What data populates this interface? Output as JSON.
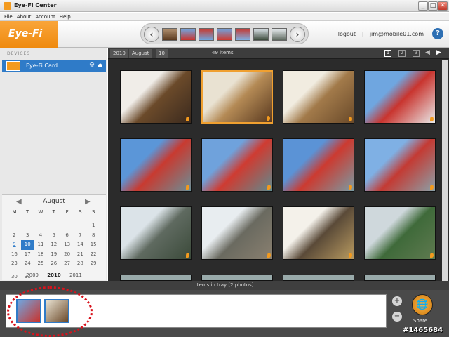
{
  "window": {
    "title": "Eye-Fi Center",
    "min": "_",
    "max": "□",
    "close": "✕"
  },
  "menu": [
    "File",
    "About",
    "Account",
    "Help"
  ],
  "header": {
    "logo": "Eye-Fi",
    "logout": "logout",
    "user": "jim@mobile01.com",
    "help": "?"
  },
  "sidebar": {
    "devices_label": "DEVICES",
    "device": "Eye-Fi Card"
  },
  "calendar": {
    "month": "August",
    "weekdays": [
      "M",
      "T",
      "W",
      "T",
      "F",
      "S",
      "S"
    ],
    "days": [
      "",
      "",
      "",
      "",
      "",
      "",
      "1",
      "2",
      "3",
      "4",
      "5",
      "6",
      "7",
      "8",
      "9",
      "10",
      "11",
      "12",
      "13",
      "14",
      "15",
      "16",
      "17",
      "18",
      "19",
      "20",
      "21",
      "22",
      "23",
      "24",
      "25",
      "26",
      "27",
      "28",
      "29",
      "30",
      "31",
      "",
      "",
      "",
      "",
      ""
    ],
    "selected_day": "10",
    "linked_day": "9",
    "years": [
      "2009",
      "2010",
      "2011"
    ],
    "current_year": "2010"
  },
  "breadcrumb": {
    "year": "2010",
    "month": "August",
    "day": "10"
  },
  "items_count": "49 items",
  "view_buttons": [
    "1",
    "2",
    "3"
  ],
  "photos": [
    {
      "name": "cookies",
      "colors": [
        "#f0ede8",
        "#6b4a2a",
        "#3b2a1e"
      ],
      "selected": false
    },
    {
      "name": "cookie-box",
      "colors": [
        "#e9e2d2",
        "#b48a55",
        "#5a3a20"
      ],
      "selected": true
    },
    {
      "name": "cookie-box-2",
      "colors": [
        "#f1ece0",
        "#a27a4a",
        "#6a4a2a"
      ],
      "selected": false
    },
    {
      "name": "building-red-1",
      "colors": [
        "#6fa6e0",
        "#c9342e",
        "#e8e8e8"
      ],
      "selected": false
    },
    {
      "name": "building-red-2",
      "colors": [
        "#5b96d8",
        "#c83a30",
        "#6b8e96"
      ],
      "selected": false
    },
    {
      "name": "building-red-3",
      "colors": [
        "#6fa2dc",
        "#cf3b31",
        "#5f8a8e"
      ],
      "selected": false
    },
    {
      "name": "building-red-4",
      "colors": [
        "#5b93d6",
        "#cc3a30",
        "#7a9aa2"
      ],
      "selected": false
    },
    {
      "name": "building-glass",
      "colors": [
        "#7fb0e4",
        "#c43a33",
        "#8aa0a8"
      ],
      "selected": false
    },
    {
      "name": "lamp-1",
      "colors": [
        "#dbe3e8",
        "#5f6a60",
        "#3b4a3a"
      ],
      "selected": false
    },
    {
      "name": "lamp-2",
      "colors": [
        "#e8edf0",
        "#6a6a60",
        "#8a8070"
      ],
      "selected": false
    },
    {
      "name": "gift-box",
      "colors": [
        "#f4f1ea",
        "#5a4a38",
        "#b89a60"
      ],
      "selected": false
    },
    {
      "name": "trees",
      "colors": [
        "#cfd8dc",
        "#3f6a3a",
        "#5f7a50"
      ],
      "selected": false
    }
  ],
  "tray": {
    "header": "Items in tray [2 photos]",
    "thumbs": [
      {
        "name": "tray-building",
        "colors": [
          "#6fa6e0",
          "#c9342e"
        ]
      },
      {
        "name": "tray-cookies",
        "colors": [
          "#e9e2d2",
          "#6b4a2a"
        ]
      }
    ],
    "zoom_in": "+",
    "zoom_out": "−",
    "share_label": "Share"
  },
  "watermark": "#1465684"
}
